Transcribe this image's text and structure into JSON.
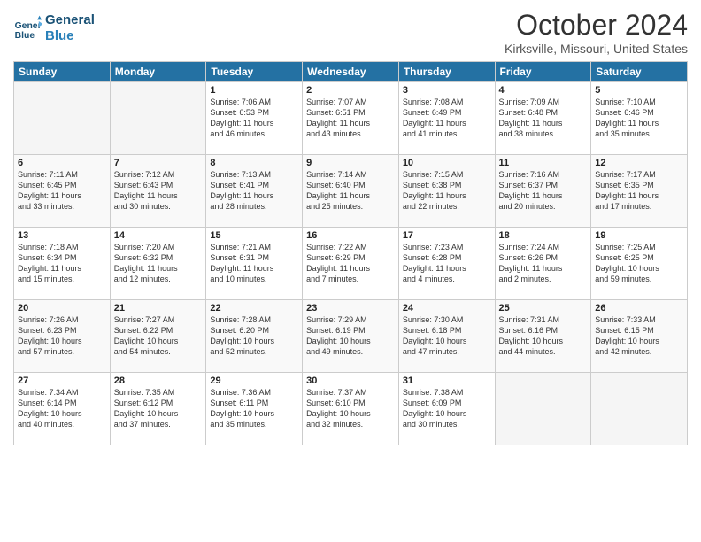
{
  "logo": {
    "line1": "General",
    "line2": "Blue"
  },
  "title": "October 2024",
  "subtitle": "Kirksville, Missouri, United States",
  "days": [
    "Sunday",
    "Monday",
    "Tuesday",
    "Wednesday",
    "Thursday",
    "Friday",
    "Saturday"
  ],
  "weeks": [
    [
      {
        "day": "",
        "empty": true
      },
      {
        "day": "",
        "empty": true
      },
      {
        "day": "1",
        "line1": "Sunrise: 7:06 AM",
        "line2": "Sunset: 6:53 PM",
        "line3": "Daylight: 11 hours",
        "line4": "and 46 minutes."
      },
      {
        "day": "2",
        "line1": "Sunrise: 7:07 AM",
        "line2": "Sunset: 6:51 PM",
        "line3": "Daylight: 11 hours",
        "line4": "and 43 minutes."
      },
      {
        "day": "3",
        "line1": "Sunrise: 7:08 AM",
        "line2": "Sunset: 6:49 PM",
        "line3": "Daylight: 11 hours",
        "line4": "and 41 minutes."
      },
      {
        "day": "4",
        "line1": "Sunrise: 7:09 AM",
        "line2": "Sunset: 6:48 PM",
        "line3": "Daylight: 11 hours",
        "line4": "and 38 minutes."
      },
      {
        "day": "5",
        "line1": "Sunrise: 7:10 AM",
        "line2": "Sunset: 6:46 PM",
        "line3": "Daylight: 11 hours",
        "line4": "and 35 minutes."
      }
    ],
    [
      {
        "day": "6",
        "line1": "Sunrise: 7:11 AM",
        "line2": "Sunset: 6:45 PM",
        "line3": "Daylight: 11 hours",
        "line4": "and 33 minutes."
      },
      {
        "day": "7",
        "line1": "Sunrise: 7:12 AM",
        "line2": "Sunset: 6:43 PM",
        "line3": "Daylight: 11 hours",
        "line4": "and 30 minutes."
      },
      {
        "day": "8",
        "line1": "Sunrise: 7:13 AM",
        "line2": "Sunset: 6:41 PM",
        "line3": "Daylight: 11 hours",
        "line4": "and 28 minutes."
      },
      {
        "day": "9",
        "line1": "Sunrise: 7:14 AM",
        "line2": "Sunset: 6:40 PM",
        "line3": "Daylight: 11 hours",
        "line4": "and 25 minutes."
      },
      {
        "day": "10",
        "line1": "Sunrise: 7:15 AM",
        "line2": "Sunset: 6:38 PM",
        "line3": "Daylight: 11 hours",
        "line4": "and 22 minutes."
      },
      {
        "day": "11",
        "line1": "Sunrise: 7:16 AM",
        "line2": "Sunset: 6:37 PM",
        "line3": "Daylight: 11 hours",
        "line4": "and 20 minutes."
      },
      {
        "day": "12",
        "line1": "Sunrise: 7:17 AM",
        "line2": "Sunset: 6:35 PM",
        "line3": "Daylight: 11 hours",
        "line4": "and 17 minutes."
      }
    ],
    [
      {
        "day": "13",
        "line1": "Sunrise: 7:18 AM",
        "line2": "Sunset: 6:34 PM",
        "line3": "Daylight: 11 hours",
        "line4": "and 15 minutes."
      },
      {
        "day": "14",
        "line1": "Sunrise: 7:20 AM",
        "line2": "Sunset: 6:32 PM",
        "line3": "Daylight: 11 hours",
        "line4": "and 12 minutes."
      },
      {
        "day": "15",
        "line1": "Sunrise: 7:21 AM",
        "line2": "Sunset: 6:31 PM",
        "line3": "Daylight: 11 hours",
        "line4": "and 10 minutes."
      },
      {
        "day": "16",
        "line1": "Sunrise: 7:22 AM",
        "line2": "Sunset: 6:29 PM",
        "line3": "Daylight: 11 hours",
        "line4": "and 7 minutes."
      },
      {
        "day": "17",
        "line1": "Sunrise: 7:23 AM",
        "line2": "Sunset: 6:28 PM",
        "line3": "Daylight: 11 hours",
        "line4": "and 4 minutes."
      },
      {
        "day": "18",
        "line1": "Sunrise: 7:24 AM",
        "line2": "Sunset: 6:26 PM",
        "line3": "Daylight: 11 hours",
        "line4": "and 2 minutes."
      },
      {
        "day": "19",
        "line1": "Sunrise: 7:25 AM",
        "line2": "Sunset: 6:25 PM",
        "line3": "Daylight: 10 hours",
        "line4": "and 59 minutes."
      }
    ],
    [
      {
        "day": "20",
        "line1": "Sunrise: 7:26 AM",
        "line2": "Sunset: 6:23 PM",
        "line3": "Daylight: 10 hours",
        "line4": "and 57 minutes."
      },
      {
        "day": "21",
        "line1": "Sunrise: 7:27 AM",
        "line2": "Sunset: 6:22 PM",
        "line3": "Daylight: 10 hours",
        "line4": "and 54 minutes."
      },
      {
        "day": "22",
        "line1": "Sunrise: 7:28 AM",
        "line2": "Sunset: 6:20 PM",
        "line3": "Daylight: 10 hours",
        "line4": "and 52 minutes."
      },
      {
        "day": "23",
        "line1": "Sunrise: 7:29 AM",
        "line2": "Sunset: 6:19 PM",
        "line3": "Daylight: 10 hours",
        "line4": "and 49 minutes."
      },
      {
        "day": "24",
        "line1": "Sunrise: 7:30 AM",
        "line2": "Sunset: 6:18 PM",
        "line3": "Daylight: 10 hours",
        "line4": "and 47 minutes."
      },
      {
        "day": "25",
        "line1": "Sunrise: 7:31 AM",
        "line2": "Sunset: 6:16 PM",
        "line3": "Daylight: 10 hours",
        "line4": "and 44 minutes."
      },
      {
        "day": "26",
        "line1": "Sunrise: 7:33 AM",
        "line2": "Sunset: 6:15 PM",
        "line3": "Daylight: 10 hours",
        "line4": "and 42 minutes."
      }
    ],
    [
      {
        "day": "27",
        "line1": "Sunrise: 7:34 AM",
        "line2": "Sunset: 6:14 PM",
        "line3": "Daylight: 10 hours",
        "line4": "and 40 minutes."
      },
      {
        "day": "28",
        "line1": "Sunrise: 7:35 AM",
        "line2": "Sunset: 6:12 PM",
        "line3": "Daylight: 10 hours",
        "line4": "and 37 minutes."
      },
      {
        "day": "29",
        "line1": "Sunrise: 7:36 AM",
        "line2": "Sunset: 6:11 PM",
        "line3": "Daylight: 10 hours",
        "line4": "and 35 minutes."
      },
      {
        "day": "30",
        "line1": "Sunrise: 7:37 AM",
        "line2": "Sunset: 6:10 PM",
        "line3": "Daylight: 10 hours",
        "line4": "and 32 minutes."
      },
      {
        "day": "31",
        "line1": "Sunrise: 7:38 AM",
        "line2": "Sunset: 6:09 PM",
        "line3": "Daylight: 10 hours",
        "line4": "and 30 minutes."
      },
      {
        "day": "",
        "empty": true
      },
      {
        "day": "",
        "empty": true
      }
    ]
  ]
}
